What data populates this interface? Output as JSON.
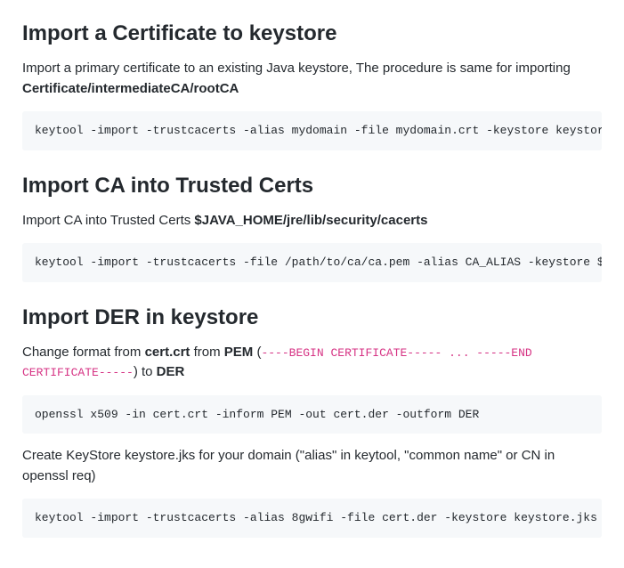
{
  "sections": [
    {
      "heading": "Import a Certificate to keystore",
      "intro_prefix": "Import a primary certificate to an existing Java keystore, The procedure is same for importing ",
      "intro_bold": "Certificate/intermediateCA/rootCA",
      "code1": "keytool -import -trustcacerts -alias mydomain -file mydomain.crt -keystore keystore.jks"
    },
    {
      "heading": "Import CA into Trusted Certs",
      "intro_prefix": "Import CA into Trusted Certs ",
      "intro_bold": "$JAVA_HOME/jre/lib/security/cacerts",
      "code1": "keytool -import -trustcacerts -file /path/to/ca/ca.pem -alias CA_ALIAS -keystore $JAVA"
    },
    {
      "heading": "Import DER in keystore",
      "p1_part1": "Change format from ",
      "p1_bold1": "cert.crt",
      "p1_part2": " from ",
      "p1_bold2": "PEM",
      "p1_part3": " (",
      "p1_code": "----BEGIN CERTIFICATE----- ... -----END CERTIFICATE-----",
      "p1_part4": ") to ",
      "p1_bold3": "DER",
      "code1": "openssl x509 -in cert.crt -inform PEM -out cert.der -outform DER",
      "p2": "Create KeyStore keystore.jks for your domain (\"alias\" in keytool, \"common name\" or CN in openssl req)",
      "code2": "keytool -import -trustcacerts -alias 8gwifi -file cert.der -keystore keystore.jks"
    }
  ]
}
